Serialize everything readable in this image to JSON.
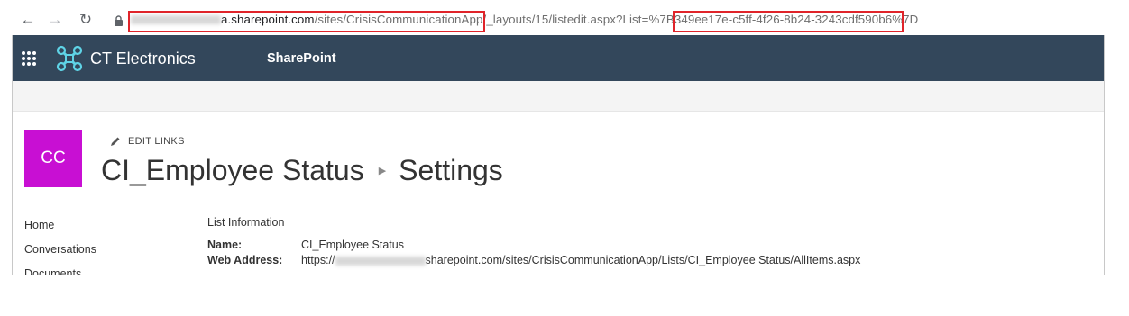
{
  "browser": {
    "url_host_blurred": "",
    "url_part1": "a.sharepoint.com",
    "url_part2": "/sites/CrisisCommunicationApp/",
    "url_part3": "_layouts/15/listedit.aspx?List=%7B",
    "url_part4": "349ee17e-c5ff-4f26-8b24-3243cdf590b6",
    "url_part5": "%7D"
  },
  "suitebar": {
    "brand": "CT Electronics",
    "app": "SharePoint"
  },
  "site": {
    "logo_text": "CC",
    "edit_links": "EDIT LINKS",
    "list_name": "CI_Employee Status",
    "page_name": "Settings"
  },
  "quicklaunch": [
    "Home",
    "Conversations",
    "Documents"
  ],
  "list_information": {
    "heading": "List Information",
    "name_label": "Name:",
    "name_value": "CI_Employee Status",
    "web_label": "Web Address:",
    "web_prefix": "https://",
    "web_suffix": "sharepoint.com/sites/CrisisCommunicationApp/Lists/CI_Employee Status/AllItems.aspx"
  },
  "colors": {
    "suitebar": "#33475b",
    "site_logo": "#c80fd3",
    "highlight": "#e0242a"
  }
}
